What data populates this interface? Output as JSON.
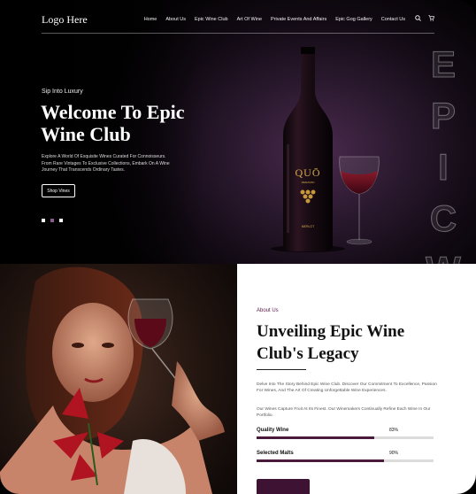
{
  "header": {
    "logo": "Logo Here",
    "nav": [
      "Home",
      "About Us",
      "Epic Wine Club",
      "Art Of Wine",
      "Private Events And Affairs",
      "Epic Gog Gallery",
      "Contact Us"
    ],
    "icons": [
      "search-icon",
      "cart-icon"
    ]
  },
  "hero": {
    "eyebrow": "Sip Into Luxury",
    "title_line1": "Welcome To Epic",
    "title_line2": "Wine Club",
    "description": "Explore A World Of Exquisite Wines Curated For Connoisseurs. From Rare Vintages To Exclusive Collections, Embark On A Wine Journey That Transcends Ordinary Tastes.",
    "button": "Shop Vines",
    "slides": 3,
    "active_slide": 2,
    "vertical_word": [
      "E",
      "P",
      "I",
      "C",
      "W"
    ],
    "bottle_brand": "QUŌ",
    "bottle_sub": "MERAMIKI",
    "bottle_label": "MERLOT"
  },
  "about": {
    "label": "About Us",
    "title_line1": "Unveiling Epic Wine",
    "title_line2": "Club's Legacy",
    "paragraph1": "Delve Into The Story Behind Epic Wine Club. Discover Our Commitment To Excellence, Passion For Wines, And The Art Of Creating Unforgettable Wine Experiences.",
    "paragraph2": "Our Wines Capture Fruit At Its Finest. Our Winemakers Continually Refine Each Wine In Our Portfolio.",
    "skills": [
      {
        "name": "Quality Wine",
        "percent": "83%",
        "value": 83
      },
      {
        "name": "Selected Malts",
        "percent": "90%",
        "value": 90
      }
    ]
  },
  "colors": {
    "accent": "#4a1a3c",
    "accent_text": "#5c1a4a",
    "hero_glow": "#4a2a4d"
  }
}
